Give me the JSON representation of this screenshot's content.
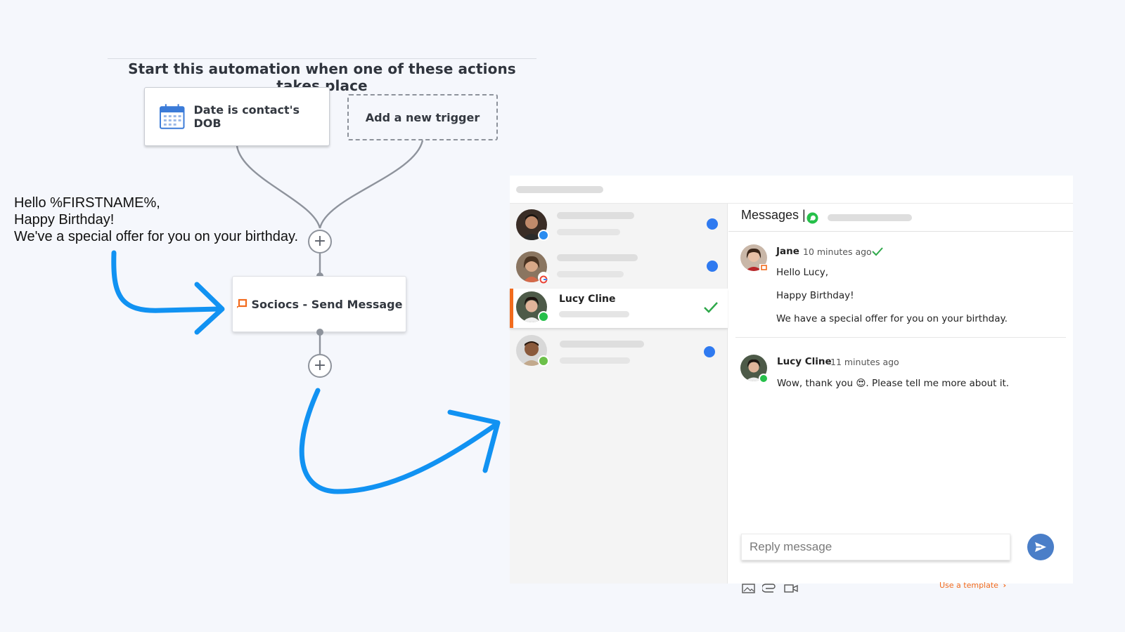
{
  "flow": {
    "title": "Start this automation when one of these actions takes place",
    "trigger": {
      "label": "Date is contact's DOB",
      "icon": "calendar-icon"
    },
    "add_trigger_label": "Add a new trigger",
    "action": {
      "label": "Sociocs - Send Message",
      "icon": "sociocs-logo-icon"
    },
    "message_lines": [
      "Hello %FIRSTNAME%,",
      "Happy Birthday!",
      "We've a special offer for you on your birthday."
    ]
  },
  "inbox": {
    "conversations": [
      {
        "name": "",
        "channel": "messenger",
        "unread": true
      },
      {
        "name": "",
        "channel": "google",
        "unread": true
      },
      {
        "name": "Lucy Cline",
        "channel": "whatsapp",
        "unread": false,
        "active": true
      },
      {
        "name": "",
        "channel": "sms",
        "unread": true
      }
    ],
    "chat": {
      "header_title": "Messages |",
      "messages": [
        {
          "sender": "Jane",
          "time": "10 minutes ago",
          "lines": [
            "Hello Lucy,",
            "Happy Birthday!",
            "We have a special offer for you on your birthday."
          ]
        },
        {
          "sender": "Lucy Cline",
          "time": "11 minutes ago",
          "text_before": "Wow, thank you ",
          "emoji": "😍",
          "text_after": ". Please tell me more about it."
        }
      ],
      "reply_placeholder": "Reply message",
      "template_link": "Use a template"
    }
  },
  "colors": {
    "accent_orange": "#f26b1d",
    "arrow_blue": "#1192f2",
    "unread_blue": "#2f7af0",
    "whatsapp_green": "#25c04a",
    "send_blue": "#4a7ec8"
  }
}
